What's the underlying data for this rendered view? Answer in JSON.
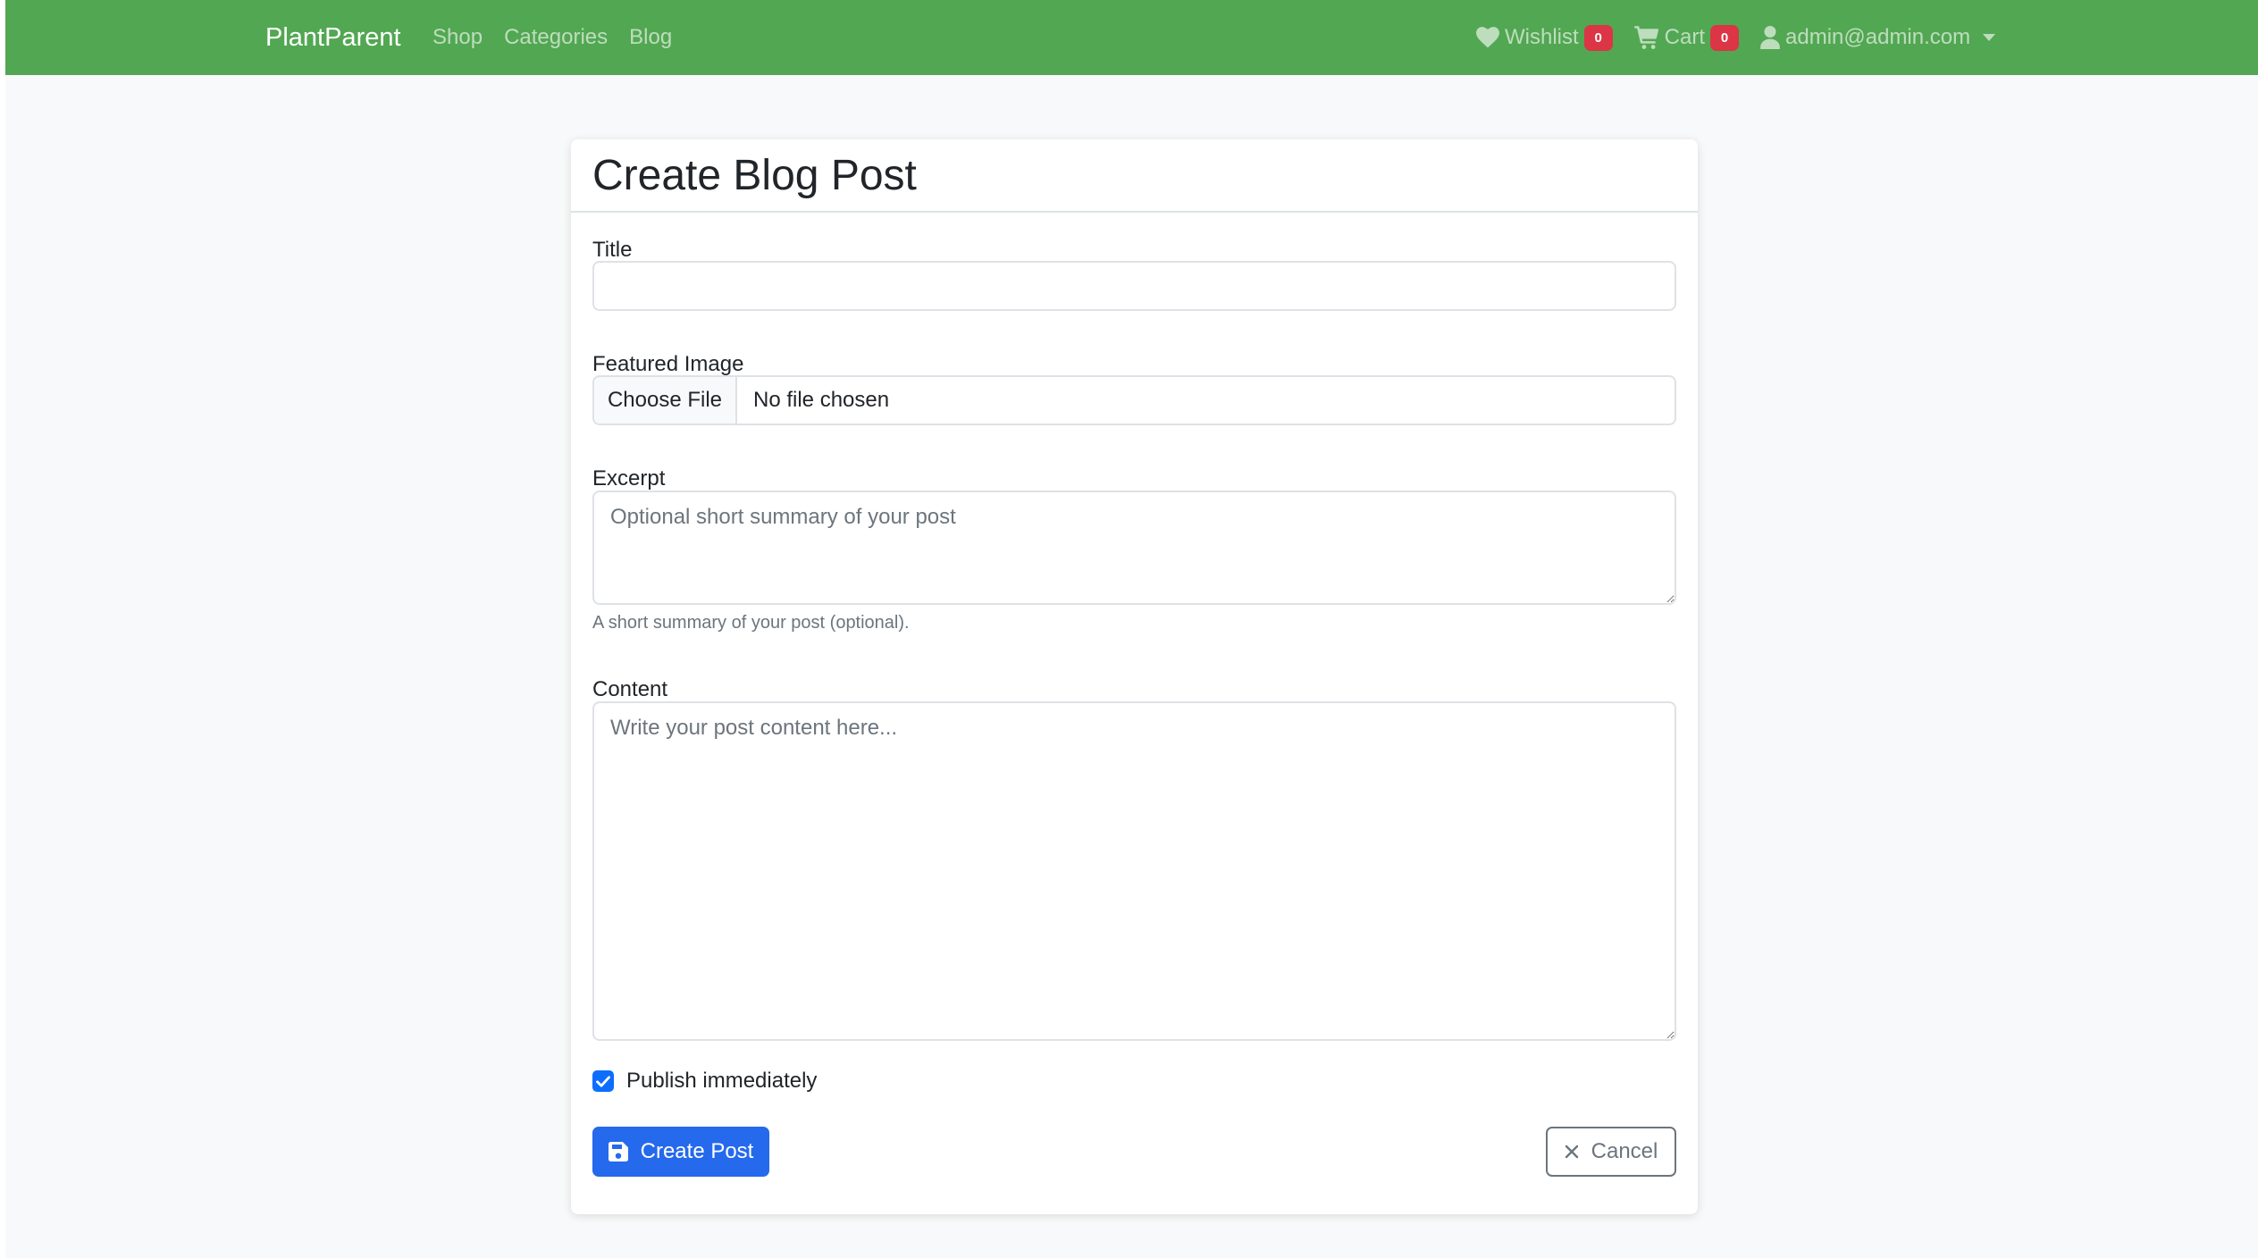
{
  "navbar": {
    "brand": "PlantParent",
    "links": [
      "Shop",
      "Categories",
      "Blog"
    ],
    "wishlist": {
      "label": "Wishlist",
      "count": "0"
    },
    "cart": {
      "label": "Cart",
      "count": "0"
    },
    "user": {
      "email": "admin@admin.com"
    }
  },
  "card": {
    "title": "Create Blog Post"
  },
  "form": {
    "title": {
      "label": "Title",
      "value": ""
    },
    "image": {
      "label": "Featured Image",
      "button": "Choose File",
      "status": "No file chosen"
    },
    "excerpt": {
      "label": "Excerpt",
      "placeholder": "Optional short summary of your post",
      "help": "A short summary of your post (optional)."
    },
    "content": {
      "label": "Content",
      "placeholder": "Write your post content here..."
    },
    "publish": {
      "label": "Publish immediately",
      "checked": true
    },
    "submit": "Create Post",
    "cancel": "Cancel"
  },
  "colors": {
    "navbar": "#52a752",
    "primary": "#2569ec",
    "badge": "#dc3545"
  }
}
